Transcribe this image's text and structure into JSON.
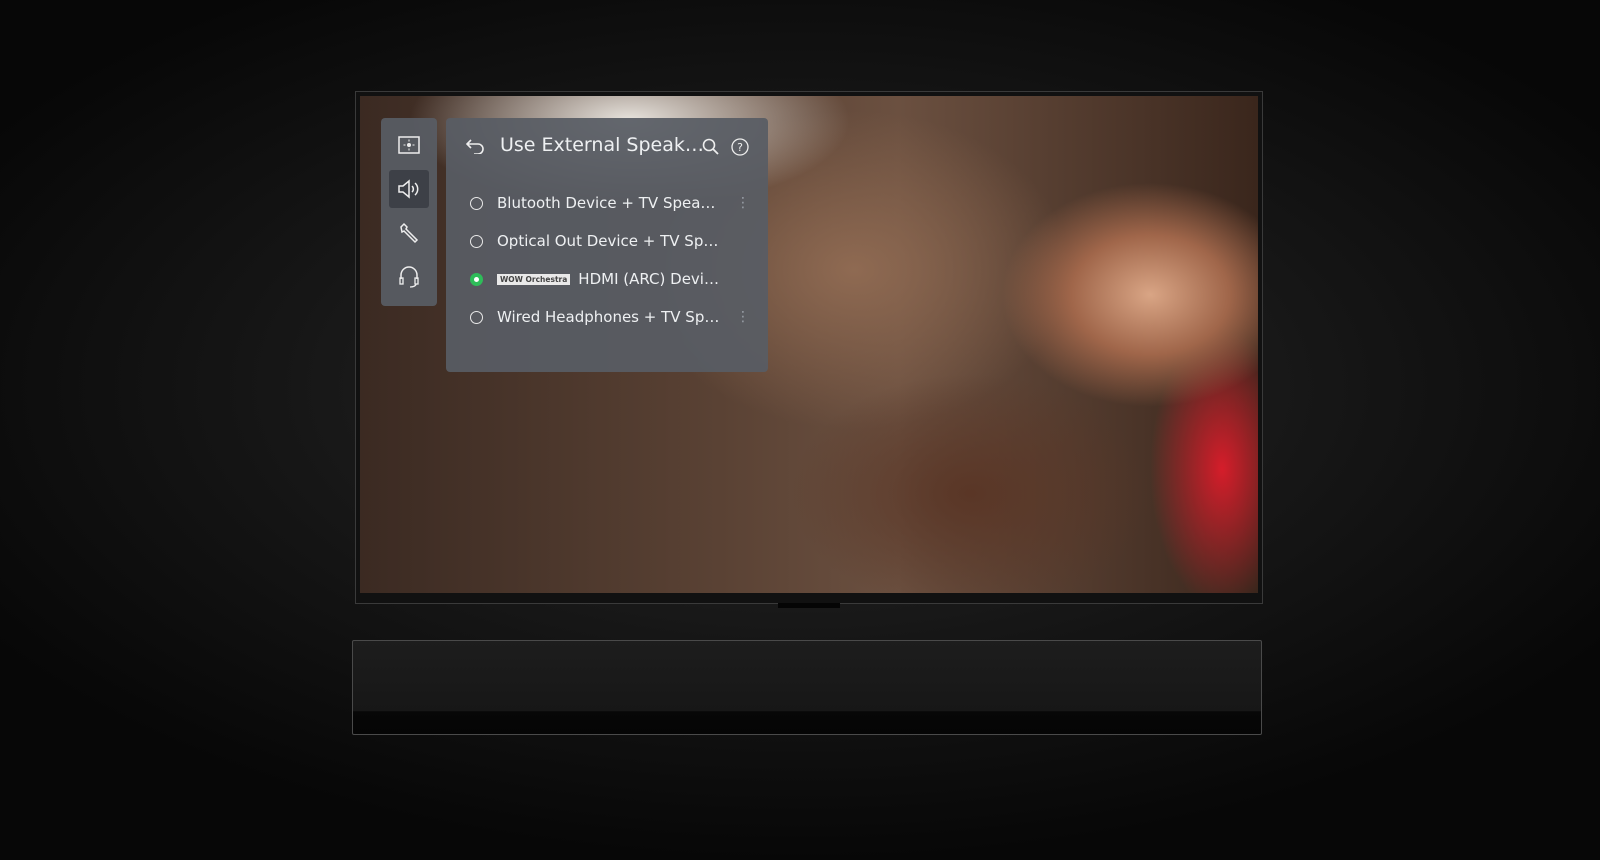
{
  "menu": {
    "title": "Use External Speak…",
    "nav": [
      {
        "icon": "picture-icon"
      },
      {
        "icon": "sound-icon",
        "active": true
      },
      {
        "icon": "wrench-icon"
      },
      {
        "icon": "headset-icon"
      }
    ],
    "options": [
      {
        "label": "Blutooth Device + TV Spea…",
        "selected": false,
        "more": true
      },
      {
        "label": "Optical Out Device + TV Sp…",
        "selected": false,
        "more": false
      },
      {
        "label": "HDMI (ARC) Devi…",
        "badge": "WOW Orchestra",
        "selected": true,
        "more": false
      },
      {
        "label": "Wired Headphones + TV Sp…",
        "selected": false,
        "more": true
      }
    ],
    "accent": "#2ebd59"
  }
}
